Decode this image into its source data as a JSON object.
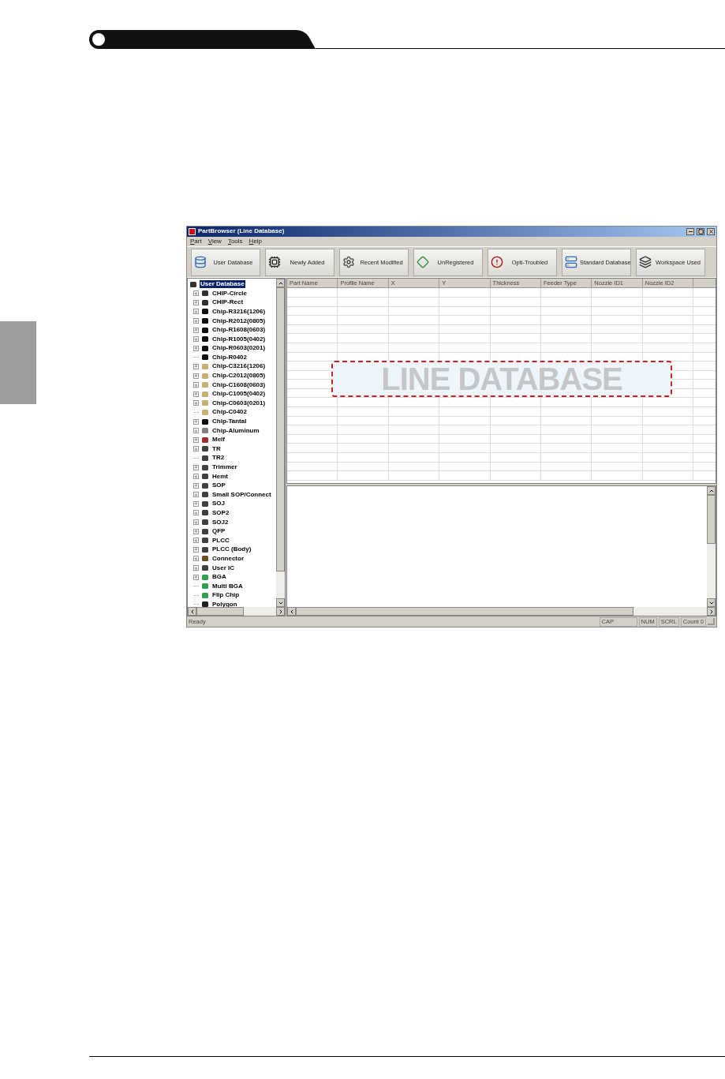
{
  "window": {
    "title": "PartBrowser (Line Database)"
  },
  "menu": [
    "Part",
    "View",
    "Tools",
    "Help"
  ],
  "toolbar": [
    "User Database",
    "Newly Added",
    "Recent Modified",
    "UnRegistered",
    "Opti-Troubled",
    "Standard Database",
    "Workspace Used"
  ],
  "tree": {
    "label": "User Database",
    "selected": true,
    "children": [
      {
        "label": "CHIP-Circle",
        "kind": "folder",
        "color": "#303030",
        "selected": false
      },
      {
        "label": "CHIP-Rect",
        "kind": "folder",
        "color": "#303030",
        "selected": false
      },
      {
        "label": "Chip-R3216(1206)",
        "kind": "folder",
        "color": "#101010",
        "selected": false
      },
      {
        "label": "Chip-R2012(0805)",
        "kind": "folder",
        "color": "#101010",
        "selected": false
      },
      {
        "label": "Chip-R1608(0603)",
        "kind": "folder",
        "color": "#101010",
        "selected": false
      },
      {
        "label": "Chip-R1005(0402)",
        "kind": "folder",
        "color": "#101010",
        "selected": false
      },
      {
        "label": "Chip-R0603(0201)",
        "kind": "folder",
        "color": "#101010",
        "selected": false
      },
      {
        "label": "Chip-R0402",
        "kind": "leaf",
        "color": "#101010",
        "selected": false
      },
      {
        "label": "Chip-C3216(1206)",
        "kind": "folder",
        "color": "#c8b070",
        "selected": false
      },
      {
        "label": "Chip-C2012(0805)",
        "kind": "folder",
        "color": "#c8b070",
        "selected": false
      },
      {
        "label": "Chip-C1608(0603)",
        "kind": "folder",
        "color": "#c8b070",
        "selected": false
      },
      {
        "label": "Chip-C1005(0402)",
        "kind": "folder",
        "color": "#c8b070",
        "selected": false
      },
      {
        "label": "Chip-C0603(0201)",
        "kind": "folder",
        "color": "#c8b070",
        "selected": false
      },
      {
        "label": "Chip-C0402",
        "kind": "leaf",
        "color": "#c8b070",
        "selected": false
      },
      {
        "label": "Chip-Tantal",
        "kind": "folder",
        "color": "#101010",
        "selected": false
      },
      {
        "label": "Chip-Aluminum",
        "kind": "folder",
        "color": "#808080",
        "selected": false
      },
      {
        "label": "Melf",
        "kind": "folder",
        "color": "#a03030",
        "selected": false
      },
      {
        "label": "TR",
        "kind": "folder",
        "color": "#404040",
        "selected": false
      },
      {
        "label": "TR2",
        "kind": "leaf",
        "color": "#404040",
        "selected": false
      },
      {
        "label": "Trimmer",
        "kind": "folder",
        "color": "#404040",
        "selected": false
      },
      {
        "label": "Hemt",
        "kind": "folder",
        "color": "#404040",
        "selected": false
      },
      {
        "label": "SOP",
        "kind": "folder",
        "color": "#404040",
        "selected": false
      },
      {
        "label": "Small SOP/Connect",
        "kind": "folder",
        "color": "#404040",
        "selected": false
      },
      {
        "label": "SOJ",
        "kind": "folder",
        "color": "#404040",
        "selected": false
      },
      {
        "label": "SOP2",
        "kind": "folder",
        "color": "#404040",
        "selected": false
      },
      {
        "label": "SOJ2",
        "kind": "folder",
        "color": "#404040",
        "selected": false
      },
      {
        "label": "QFP",
        "kind": "folder",
        "color": "#404040",
        "selected": false
      },
      {
        "label": "PLCC",
        "kind": "folder",
        "color": "#404040",
        "selected": false
      },
      {
        "label": "PLCC (Body)",
        "kind": "folder",
        "color": "#404040",
        "selected": false
      },
      {
        "label": "Connector",
        "kind": "folder",
        "color": "#6a5020",
        "selected": false
      },
      {
        "label": "User IC",
        "kind": "folder",
        "color": "#404040",
        "selected": false
      },
      {
        "label": "BGA",
        "kind": "folder",
        "color": "#30a050",
        "selected": false
      },
      {
        "label": "Multi BGA",
        "kind": "leaf",
        "color": "#30a050",
        "selected": false
      },
      {
        "label": "Flip Chip",
        "kind": "leaf",
        "color": "#30a050",
        "selected": false
      },
      {
        "label": "Polygon",
        "kind": "leaf",
        "color": "#202020",
        "selected": false
      }
    ]
  },
  "table": {
    "columns": [
      "Part Name",
      "Profile Name",
      "X",
      "Y",
      "Thickness",
      "Feeder Type",
      "Nozzle ID1",
      "Nozzle ID2"
    ]
  },
  "annotation": "LINE DATABASE",
  "status_bar": [
    "Ready",
    "CAP",
    "NUM",
    "SCRL",
    "Count 0"
  ]
}
